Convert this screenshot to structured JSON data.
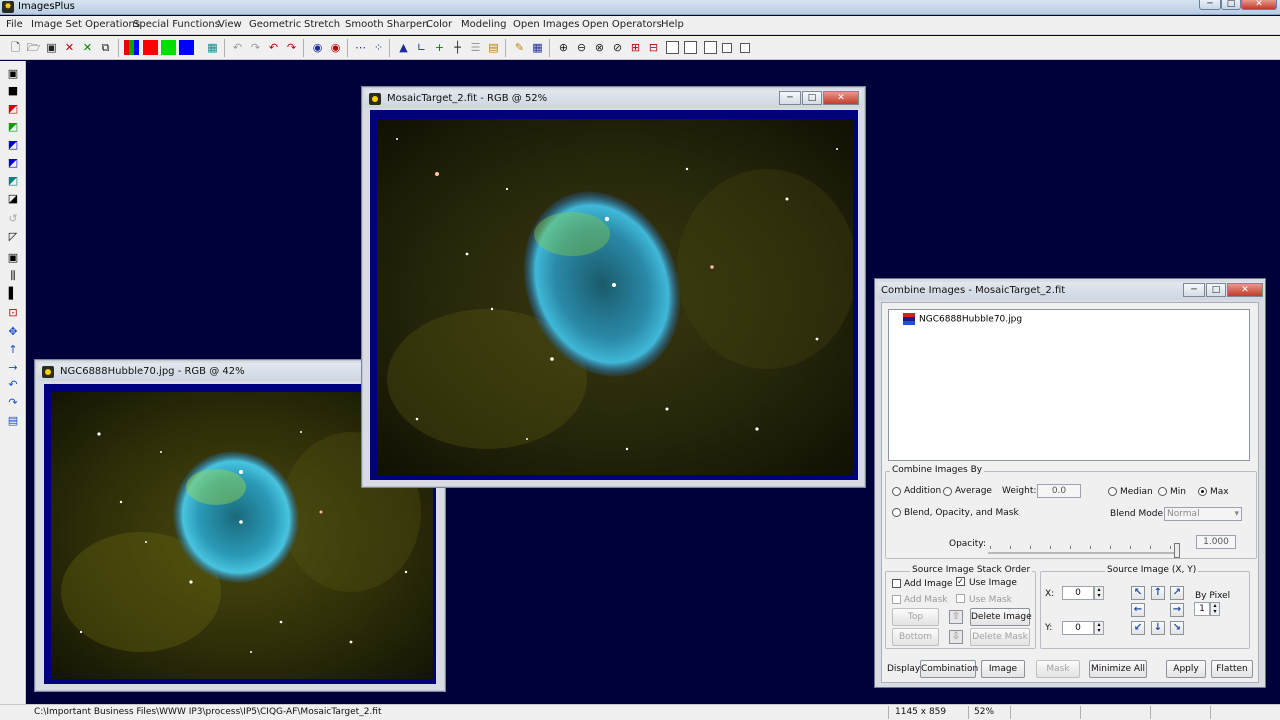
{
  "app": {
    "title": "ImagesPlus"
  },
  "menu": [
    "File",
    "Image Set Operations",
    "Special Functions",
    "View",
    "Geometric",
    "Stretch",
    "Smooth Sharpen",
    "Color",
    "Modeling",
    "Open Images",
    "Open Operators",
    "Help"
  ],
  "windows": {
    "mosaic": {
      "title": "MosaicTarget_2.fit - RGB @ 52%"
    },
    "hubble": {
      "title": "NGC6888Hubble70.jpg - RGB @ 42%"
    }
  },
  "combine": {
    "title": "Combine Images - MosaicTarget_2.fit",
    "tree_item": "NGC6888Hubble70.jpg",
    "combine_by": {
      "label": "Combine Images By",
      "addition": "Addition",
      "average": "Average",
      "weight_label": "Weight:",
      "weight_value": "0.0",
      "median": "Median",
      "min": "Min",
      "max": "Max",
      "selected": "Max",
      "blend": "Blend, Opacity, and Mask",
      "blend_mode_label": "Blend Mode:",
      "blend_mode_value": "Normal",
      "opacity_label": "Opacity:",
      "opacity_value": "1.000",
      "opacity_fraction": 1.0
    },
    "stack": {
      "label": "Source Image Stack Order",
      "add_image": "Add Image",
      "use_image": "Use Image",
      "use_image_checked": true,
      "add_mask": "Add Mask",
      "use_mask": "Use Mask",
      "top": "Top",
      "bottom": "Bottom",
      "delete_image": "Delete Image",
      "delete_mask": "Delete Mask"
    },
    "source_xy": {
      "label": "Source Image (X, Y)",
      "x_label": "X:",
      "x_value": "0",
      "y_label": "Y:",
      "y_value": "0",
      "by_pixel_label": "By Pixel",
      "by_pixel_value": "1"
    },
    "display": {
      "label": "Display:",
      "combination": "Combination",
      "image": "Image",
      "mask": "Mask",
      "minimize_all": "Minimize All",
      "apply": "Apply",
      "flatten": "Flatten"
    }
  },
  "status": {
    "path": "C:\\Important Business Files\\WWW IP3\\process\\IP5\\CIQG-AF\\MosaicTarget_2.fit",
    "dimensions": "1145 x 859",
    "zoom": "52%"
  },
  "colors": {
    "workspace": "#00003a",
    "image_frame": "#00007e",
    "nebula": "#2fb3c8"
  }
}
